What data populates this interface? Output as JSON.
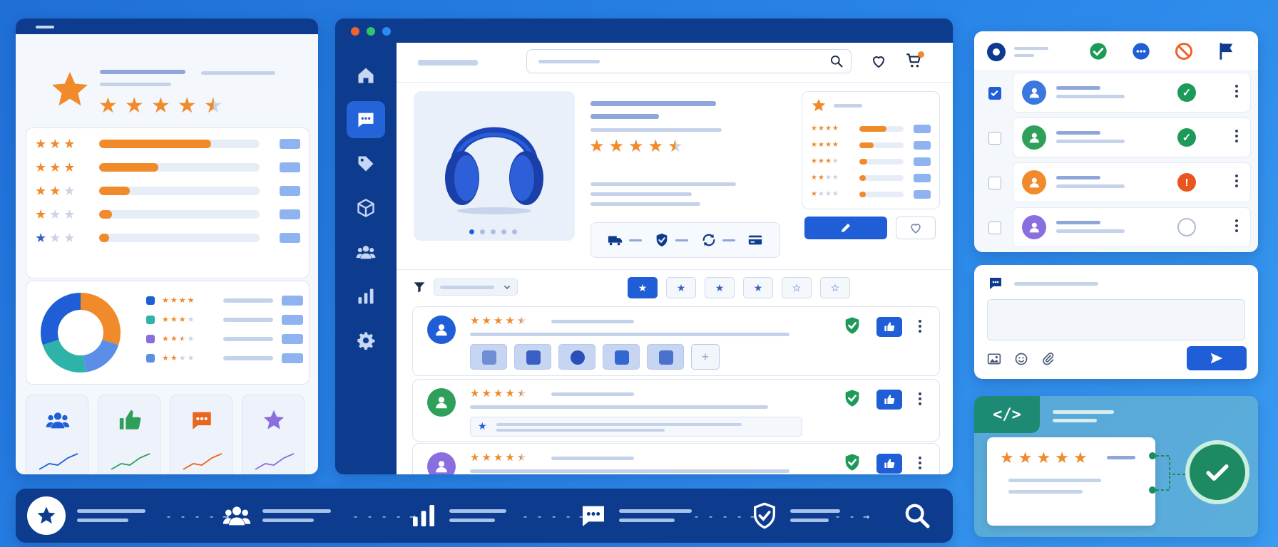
{
  "left_panel": {
    "summary_rating": 4.5,
    "distribution": [
      {
        "stars": 5,
        "fill": 0.7
      },
      {
        "stars": 4,
        "fill": 0.37
      },
      {
        "stars": 3,
        "fill": 0.19
      },
      {
        "stars": 2,
        "fill": 0.08
      },
      {
        "stars": 1,
        "fill": 0.06
      }
    ],
    "donut_segments": [
      {
        "color": "#f08a2a",
        "share": 0.3
      },
      {
        "color": "#5a8ee8",
        "share": 0.18
      },
      {
        "color": "#2eb3a8",
        "share": 0.22
      },
      {
        "color": "#1f5ed6",
        "share": 0.3
      }
    ],
    "legend": [
      {
        "color": "#1f5ed6",
        "stars": 4.5
      },
      {
        "color": "#2eb3a8",
        "stars": 3
      },
      {
        "color": "#8a6ee0",
        "stars": 2.5
      },
      {
        "color": "#5a8ee8",
        "stars": 2
      }
    ],
    "stat_cards": [
      {
        "icon": "users-icon",
        "color": "#1f5ed6",
        "trend_color": "#1f5ed6"
      },
      {
        "icon": "thumbs-up-icon",
        "color": "#2ea05a",
        "trend_color": "#2ea05a"
      },
      {
        "icon": "chat-bubble-icon",
        "color": "#e8661e",
        "trend_color": "#e8661e"
      },
      {
        "icon": "star-icon",
        "color": "#8a6ee0",
        "trend_color": "#8a6ee0"
      }
    ]
  },
  "main_window": {
    "window_dots": [
      "#f0632a",
      "#2ec46b",
      "#2a8cf0"
    ],
    "sidebar": [
      {
        "icon": "home-icon",
        "active": false
      },
      {
        "icon": "chat-icon",
        "active": true
      },
      {
        "icon": "tag-icon",
        "active": false
      },
      {
        "icon": "box-icon",
        "active": false
      },
      {
        "icon": "users-icon",
        "active": false
      },
      {
        "icon": "bar-chart-icon",
        "active": false
      },
      {
        "icon": "gear-icon",
        "active": false
      }
    ],
    "product": {
      "image": "headphones-image",
      "rating": 4.5,
      "carousel_dots": 5,
      "carousel_active": 0,
      "trust_icons": [
        "truck-icon",
        "shield-check-icon",
        "refresh-icon",
        "credit-card-icon"
      ]
    },
    "mini_distribution": [
      {
        "stars": 5,
        "fill": 0.62
      },
      {
        "stars": 4,
        "fill": 0.32
      },
      {
        "stars": 3,
        "fill": 0.18
      },
      {
        "stars": 2,
        "fill": 0.14
      },
      {
        "stars": 1,
        "fill": 0.14
      }
    ],
    "filter_buttons": [
      {
        "label": "★",
        "active": true
      },
      {
        "label": "★",
        "active": false
      },
      {
        "label": "★",
        "active": false
      },
      {
        "label": "★",
        "active": false
      },
      {
        "label": "☆",
        "active": false
      },
      {
        "label": "☆",
        "active": false
      }
    ],
    "reviews": [
      {
        "avatar_color": "#1f5ed6",
        "rating": 4.5,
        "has_photos": true
      },
      {
        "avatar_color": "#2ea05a",
        "rating": 4.5,
        "has_quote": true
      },
      {
        "avatar_color": "#8a6ee0",
        "rating": 4.5
      }
    ],
    "cart_badge_color": "#f08a2a"
  },
  "moderation": {
    "header_actions": [
      {
        "icon": "check-circle-icon",
        "color": "#1d9a5a"
      },
      {
        "icon": "chat-bubble-icon",
        "color": "#1f5ed6"
      },
      {
        "icon": "ban-icon",
        "color": "#f0632a"
      },
      {
        "icon": "flag-icon",
        "color": "#0d3c8f"
      }
    ],
    "rows": [
      {
        "checked": true,
        "avatar_color": "#3a78e0",
        "status": "approved"
      },
      {
        "checked": false,
        "avatar_color": "#2ea05a",
        "status": "approved"
      },
      {
        "checked": false,
        "avatar_color": "#f08a2a",
        "status": "warning"
      },
      {
        "checked": false,
        "avatar_color": "#8a6ee0",
        "status": "pending"
      }
    ]
  },
  "composer": {
    "attach_icons": [
      "image-icon",
      "smiley-icon",
      "paperclip-icon"
    ],
    "send_icon": "send-icon"
  },
  "code_widget": {
    "tag_label": "</>",
    "rating": 5
  },
  "flow_steps": [
    {
      "icon": "star-icon"
    },
    {
      "icon": "users-icon"
    },
    {
      "icon": "bar-chart-icon"
    },
    {
      "icon": "chat-bubble-icon"
    },
    {
      "icon": "shield-check-icon"
    },
    {
      "icon": "search-icon"
    }
  ]
}
